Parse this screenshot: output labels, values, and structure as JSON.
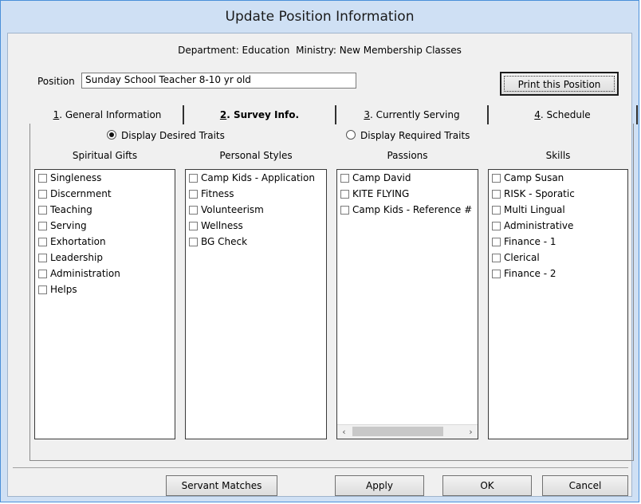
{
  "window": {
    "title": "Update Position Information"
  },
  "header": {
    "department": "Department: Education",
    "ministry": "Ministry: New Membership Classes"
  },
  "position": {
    "label": "Position",
    "value": "Sunday School Teacher 8-10 yr old"
  },
  "buttons": {
    "print": "Print this Position",
    "servant_matches": "Servant Matches",
    "apply": "Apply",
    "ok": "OK",
    "cancel": "Cancel"
  },
  "tabs": [
    {
      "key": "1",
      "label": ". General Information"
    },
    {
      "key": "2",
      "label": ". Survey Info."
    },
    {
      "key": "3",
      "label": ". Currently Serving"
    },
    {
      "key": "4",
      "label": ". Schedule"
    }
  ],
  "radios": {
    "desired": "Display Desired Traits",
    "required": "Display Required Traits",
    "selected": "desired"
  },
  "columns": [
    {
      "title": "Spiritual Gifts",
      "items": [
        "Singleness",
        "Discernment",
        "Teaching",
        "Serving",
        "Exhortation",
        "Leadership",
        "Administration",
        "Helps"
      ]
    },
    {
      "title": "Personal Styles",
      "items": [
        "Camp Kids - Application",
        "Fitness",
        "Volunteerism",
        "Wellness",
        "BG Check"
      ]
    },
    {
      "title": "Passions",
      "items": [
        "Camp David",
        "KITE FLYING",
        "Camp Kids - Reference #"
      ]
    },
    {
      "title": "Skills",
      "items": [
        "Camp Susan",
        "RISK - Sporatic",
        "Multi Lingual",
        "Administrative",
        "Finance - 1",
        "Clerical",
        "Finance - 2"
      ]
    }
  ],
  "icons": {
    "scroll_left": "‹",
    "scroll_right": "›"
  }
}
